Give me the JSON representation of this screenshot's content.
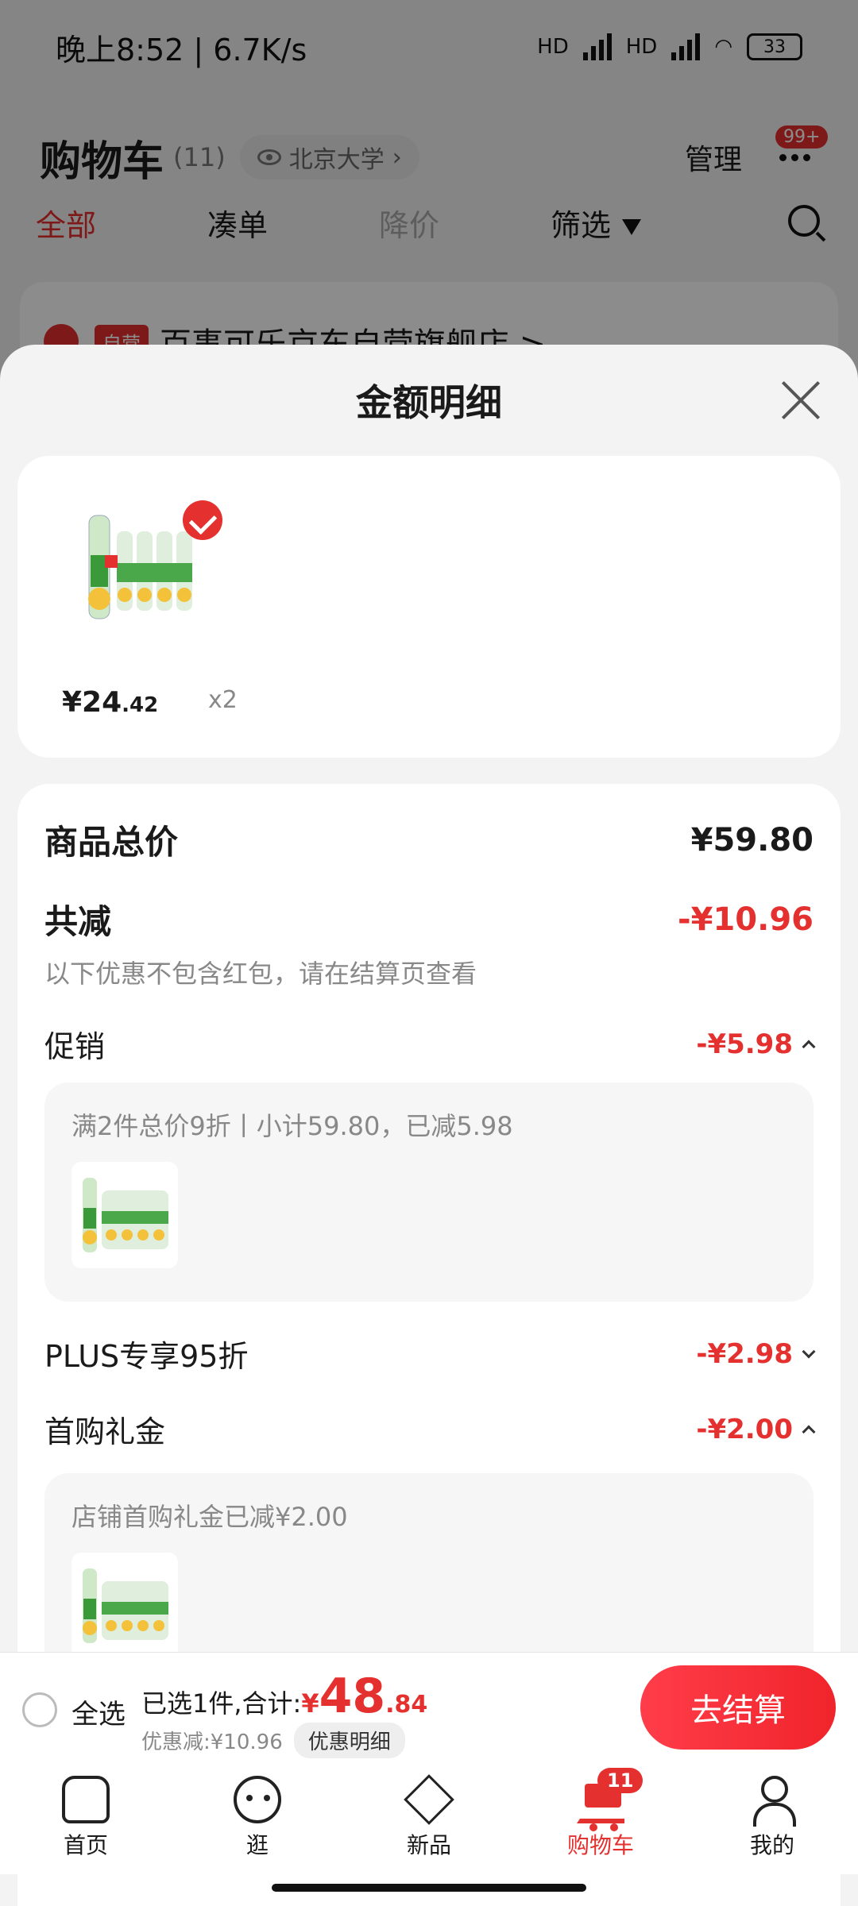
{
  "status_bar": {
    "time_speed": "晚上8:52 | 6.7K/s",
    "hd1": "HD",
    "hd2": "HD",
    "battery": "33"
  },
  "cart_header": {
    "title": "购物车",
    "count": "(11)",
    "location": "北京大学",
    "manage": "管理",
    "badge": "99+"
  },
  "cart_tabs": [
    "全部",
    "凑单",
    "降价",
    "筛选"
  ],
  "store": {
    "tag": "自营",
    "name": "百事可乐京东自营旗舰店 >"
  },
  "sheet": {
    "title": "金额明细",
    "product": {
      "price_int": "¥24",
      "price_dec": ".42",
      "qty": "x2"
    },
    "total_label": "商品总价",
    "total_value": "¥59.80",
    "reduce_label": "共减",
    "reduce_value": "-¥10.96",
    "reduce_note": "以下优惠不包含红包，请在结算页查看",
    "promo_label": "促销",
    "promo_value": "-¥5.98",
    "promo_detail": "满2件总价9折丨小计59.80，已减5.98",
    "plus_label": "PLUS专享95折",
    "plus_value": "-¥2.98",
    "first_label": "首购礼金",
    "first_value": "-¥2.00",
    "first_detail": "店铺首购礼金已减¥2.00"
  },
  "checkout": {
    "select_all": "全选",
    "summary_prefix": "已选1件,合计:",
    "currency": "¥",
    "total_int": "48",
    "total_dec": ".84",
    "discount": "优惠减:¥10.96",
    "detail_button": "优惠明细",
    "checkout_button": "去结算"
  },
  "tab_bar": {
    "items": [
      "首页",
      "逛",
      "新品",
      "购物车",
      "我的"
    ],
    "cart_badge": "11"
  },
  "colors": {
    "accent": "#e4312f"
  }
}
